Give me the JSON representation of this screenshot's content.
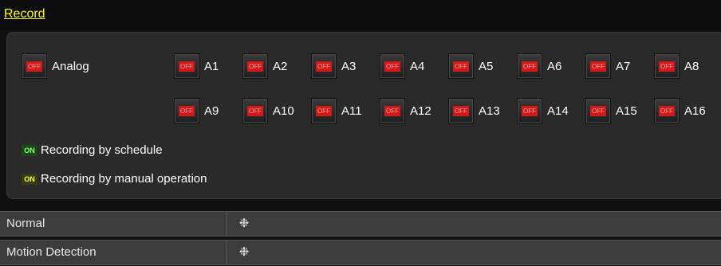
{
  "header": {
    "title": "Record"
  },
  "analog": {
    "label": "Analog",
    "button_text": "OFF"
  },
  "channels_row1": [
    {
      "label": "A1",
      "state": "OFF"
    },
    {
      "label": "A2",
      "state": "OFF"
    },
    {
      "label": "A3",
      "state": "OFF"
    },
    {
      "label": "A4",
      "state": "OFF"
    },
    {
      "label": "A5",
      "state": "OFF"
    },
    {
      "label": "A6",
      "state": "OFF"
    },
    {
      "label": "A7",
      "state": "OFF"
    },
    {
      "label": "A8",
      "state": "OFF"
    }
  ],
  "channels_row2": [
    {
      "label": "A9",
      "state": "OFF"
    },
    {
      "label": "A10",
      "state": "OFF"
    },
    {
      "label": "A11",
      "state": "OFF"
    },
    {
      "label": "A12",
      "state": "OFF"
    },
    {
      "label": "A13",
      "state": "OFF"
    },
    {
      "label": "A14",
      "state": "OFF"
    },
    {
      "label": "A15",
      "state": "OFF"
    },
    {
      "label": "A16",
      "state": "OFF"
    }
  ],
  "legend": {
    "schedule": {
      "badge": "ON",
      "text": "Recording by schedule"
    },
    "manual": {
      "badge": "ON",
      "text": "Recording by manual operation"
    }
  },
  "modes": [
    {
      "label": "Normal",
      "icon": "gear-icon"
    },
    {
      "label": "Motion Detection",
      "icon": "gear-icon"
    }
  ]
}
